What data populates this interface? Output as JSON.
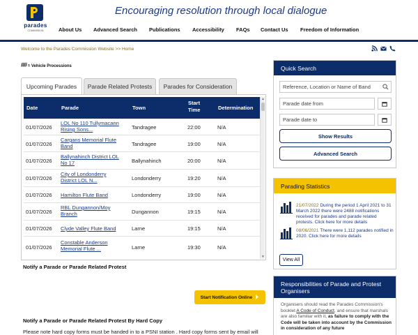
{
  "header": {
    "logo_text": "parades",
    "logo_sub": "COMMISSION",
    "tagline": "Encouraging resolution through local dialogue"
  },
  "nav": {
    "items": [
      "About Us",
      "Advanced Search",
      "Publications",
      "Accessibility",
      "FAQs",
      "Contact Us",
      "Freedom of Information"
    ]
  },
  "breadcrumb": "Welcome to the Parades Commission Website >> Home",
  "legend": {
    "symbol": "##",
    "text": "= Vehicle Processions"
  },
  "tabs": [
    "Upcoming Parades",
    "Parade Related Protests",
    "Parades for Consideration"
  ],
  "table": {
    "headers": {
      "date": "Date",
      "parade": "Parade",
      "town": "Town",
      "start_time_1": "Start",
      "start_time_2": "Time",
      "determination": "Determination"
    },
    "rows": [
      {
        "date": "01/07/2026",
        "parade_1": "LOL No 110 Tullymacann",
        "parade_2": "Rising Sons...",
        "town": "Tandragee",
        "time": "22:00",
        "determination": "N/A"
      },
      {
        "date": "01/07/2026",
        "parade_1": "Cargans Memorial Flute",
        "parade_2": "Band",
        "town": "Tandragee",
        "time": "19:00",
        "determination": "N/A"
      },
      {
        "date": "01/07/2026",
        "parade_1": "Ballynahinch District LOL",
        "parade_2": "No 17",
        "town": "Ballynahinch",
        "time": "20:00",
        "determination": "N/A"
      },
      {
        "date": "01/07/2026",
        "parade_1": "City of Londonderry",
        "parade_2": "District LOL N...",
        "town": "Londonderry",
        "time": "19:20",
        "determination": "N/A"
      },
      {
        "date": "01/07/2026",
        "parade_1": "Hamilton Flute Band",
        "parade_2": "",
        "town": "Londonderry",
        "time": "19:00",
        "determination": "N/A"
      },
      {
        "date": "01/07/2026",
        "parade_1": "RBL Dungannon/Moy",
        "parade_2": "Branch",
        "town": "Dungannon",
        "time": "19:15",
        "determination": "N/A"
      },
      {
        "date": "01/07/2026",
        "parade_1": "Clyde Valley Flute Band",
        "parade_2": "",
        "town": "Larne",
        "time": "19:15",
        "determination": "N/A"
      },
      {
        "date": "01/07/2026",
        "parade_1": "Constable Anderson",
        "parade_2": "Memorial Flute ...",
        "town": "Larne",
        "time": "19:30",
        "determination": "N/A"
      }
    ]
  },
  "notify": {
    "title": "Notify a Parade or Parade Related Protest",
    "button": "Start Notification Online",
    "hardcopy_title": "Notify a Parade or Parade Related Protest By Hard Copy",
    "hardcopy_text": "Please note hard copy forms must be handed in to a PSNI station .  Hard copy forms sent by email will"
  },
  "quick_search": {
    "title": "Quick Search",
    "search_placeholder": "Reference, Location or Name of Band",
    "date_from_placeholder": "Parade date from",
    "date_to_placeholder": "Parade date to",
    "show_results": "Show Results",
    "advanced_search": "Advanced Search"
  },
  "stats": {
    "title": "Parading Statistics",
    "items": [
      {
        "date": "21/07/2022",
        "text": "During the period 1 April 2021 to 31 March 2022 there were 2488 notifications received for parades and parade related protests. Click here for more details"
      },
      {
        "date": "08/06/2021",
        "text": "There were 1,112 parades notified in 2020. Click here for more details"
      }
    ],
    "view_all": "View All"
  },
  "responsibilities": {
    "title": "Responsibilities of Parade and Protest Organisers",
    "text_1": "Organisers should read the Parades Commission's booklet ",
    "code_link": "A Code of Conduct",
    "text_2": ", and ensure that marshals are also familiar with it, ",
    "text_bold": "as failure to comply with the Code will be taken into account by the Commission in consideration of any future"
  },
  "colors": {
    "navy": "#0c2c6a",
    "yellow": "#f5c200",
    "link": "#1a3a8a",
    "breadcrumb": "#8a6d18"
  },
  "icons": [
    "rss-icon",
    "email-icon",
    "phone-icon",
    "search-icon",
    "calendar-icon",
    "chart-icon",
    "arrow-right-icon"
  ]
}
